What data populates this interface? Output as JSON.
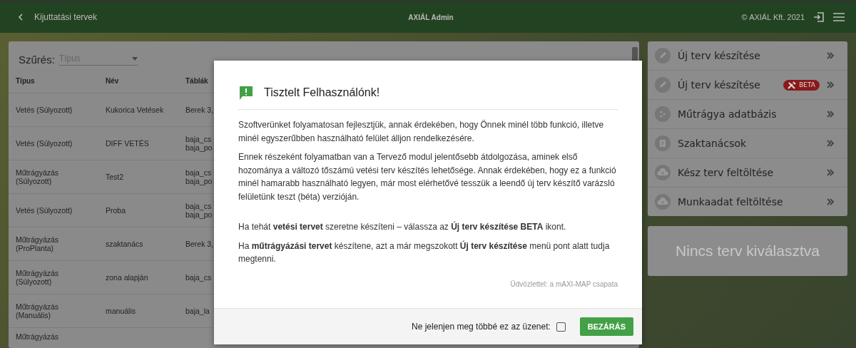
{
  "header": {
    "back_label": "Kijuttatási tervek",
    "title": "AXIÁL Admin",
    "copyright": "© AXIÁL Kft. 2021"
  },
  "filter": {
    "label": "Szűrés:",
    "placeholder": "Típus"
  },
  "table": {
    "columns": [
      "Típus",
      "Név",
      "Táblák"
    ],
    "rows": [
      {
        "type": "Vetés (Súlyozott)",
        "name": "Kukorica Vetések",
        "fields": [
          "Berek 3,"
        ]
      },
      {
        "type": "Vetés (Súlyozott)",
        "name": "DIFF VETÉS",
        "fields": [
          "baja_cs",
          "baja_po"
        ]
      },
      {
        "type": "Műtrágyázás (Súlyozott)",
        "name": "Test2",
        "fields": [
          "baja_cs",
          "baja_po"
        ]
      },
      {
        "type": "Vetés (Súlyozott)",
        "name": "Proba",
        "fields": [
          "baja_cs",
          "baja_po"
        ]
      },
      {
        "type": "Műtrágyázás (ProPlanta)",
        "name": "szaktanács",
        "fields": [
          "Berek 3,"
        ]
      },
      {
        "type": "Műtrágyázás (Súlyozott)",
        "name": "zona alapján",
        "fields": [
          "baja_cs"
        ]
      },
      {
        "type": "Műtrágyázás (Manuális)",
        "name": "manuális",
        "fields": [
          "baja_la"
        ]
      },
      {
        "type": "Műtrágyázás",
        "name": "",
        "fields": []
      }
    ]
  },
  "modal": {
    "title": "Tisztelt Felhasználónk!",
    "paragraphs": [
      "Szoftverünket folyamatosan fejlesztjük, annak érdekében, hogy Önnek minél több funkció, illetve minél egyszerűbben használható felület álljon rendelkezésére.",
      "Ennek részeként folyamatban van a Tervező modul jelentősebb átdolgozása, aminek első hozománya a változó tőszámú vetési terv készítés lehetősége. Annak érdekében, hogy ez a funkció minél hamarabb használható legyen, már most elérhetővé tesszük a leendő új terv készítő varázsló felületünk teszt (béta) verzióján.",
      "Ha tehát **vetési tervet** szeretne készíteni – válassza az **Új terv készítése BETA** ikont.",
      "Ha **műtrágyázási tervet** készítene, azt a már megszokott **Új terv készítése** menü pont alatt tudja megtenni."
    ],
    "signature": "Üdvözlettel: a mAXI-MAP csapata",
    "dont_show": {
      "label": "Ne jelenjen meg többé ez az üzenet:",
      "checked": false
    },
    "close_button": "BEZÁRÁS"
  },
  "menu": [
    {
      "label": "Új terv készítése"
    },
    {
      "label": "Új terv készítése",
      "badge": "BETA"
    },
    {
      "label": "Műtrágya adatbázis"
    },
    {
      "label": "Szaktanácsok"
    },
    {
      "label": "Kész terv feltöltése"
    },
    {
      "label": "Munkaadat feltöltése"
    }
  ],
  "empty_panel": "Nincs terv kiválasztva"
}
